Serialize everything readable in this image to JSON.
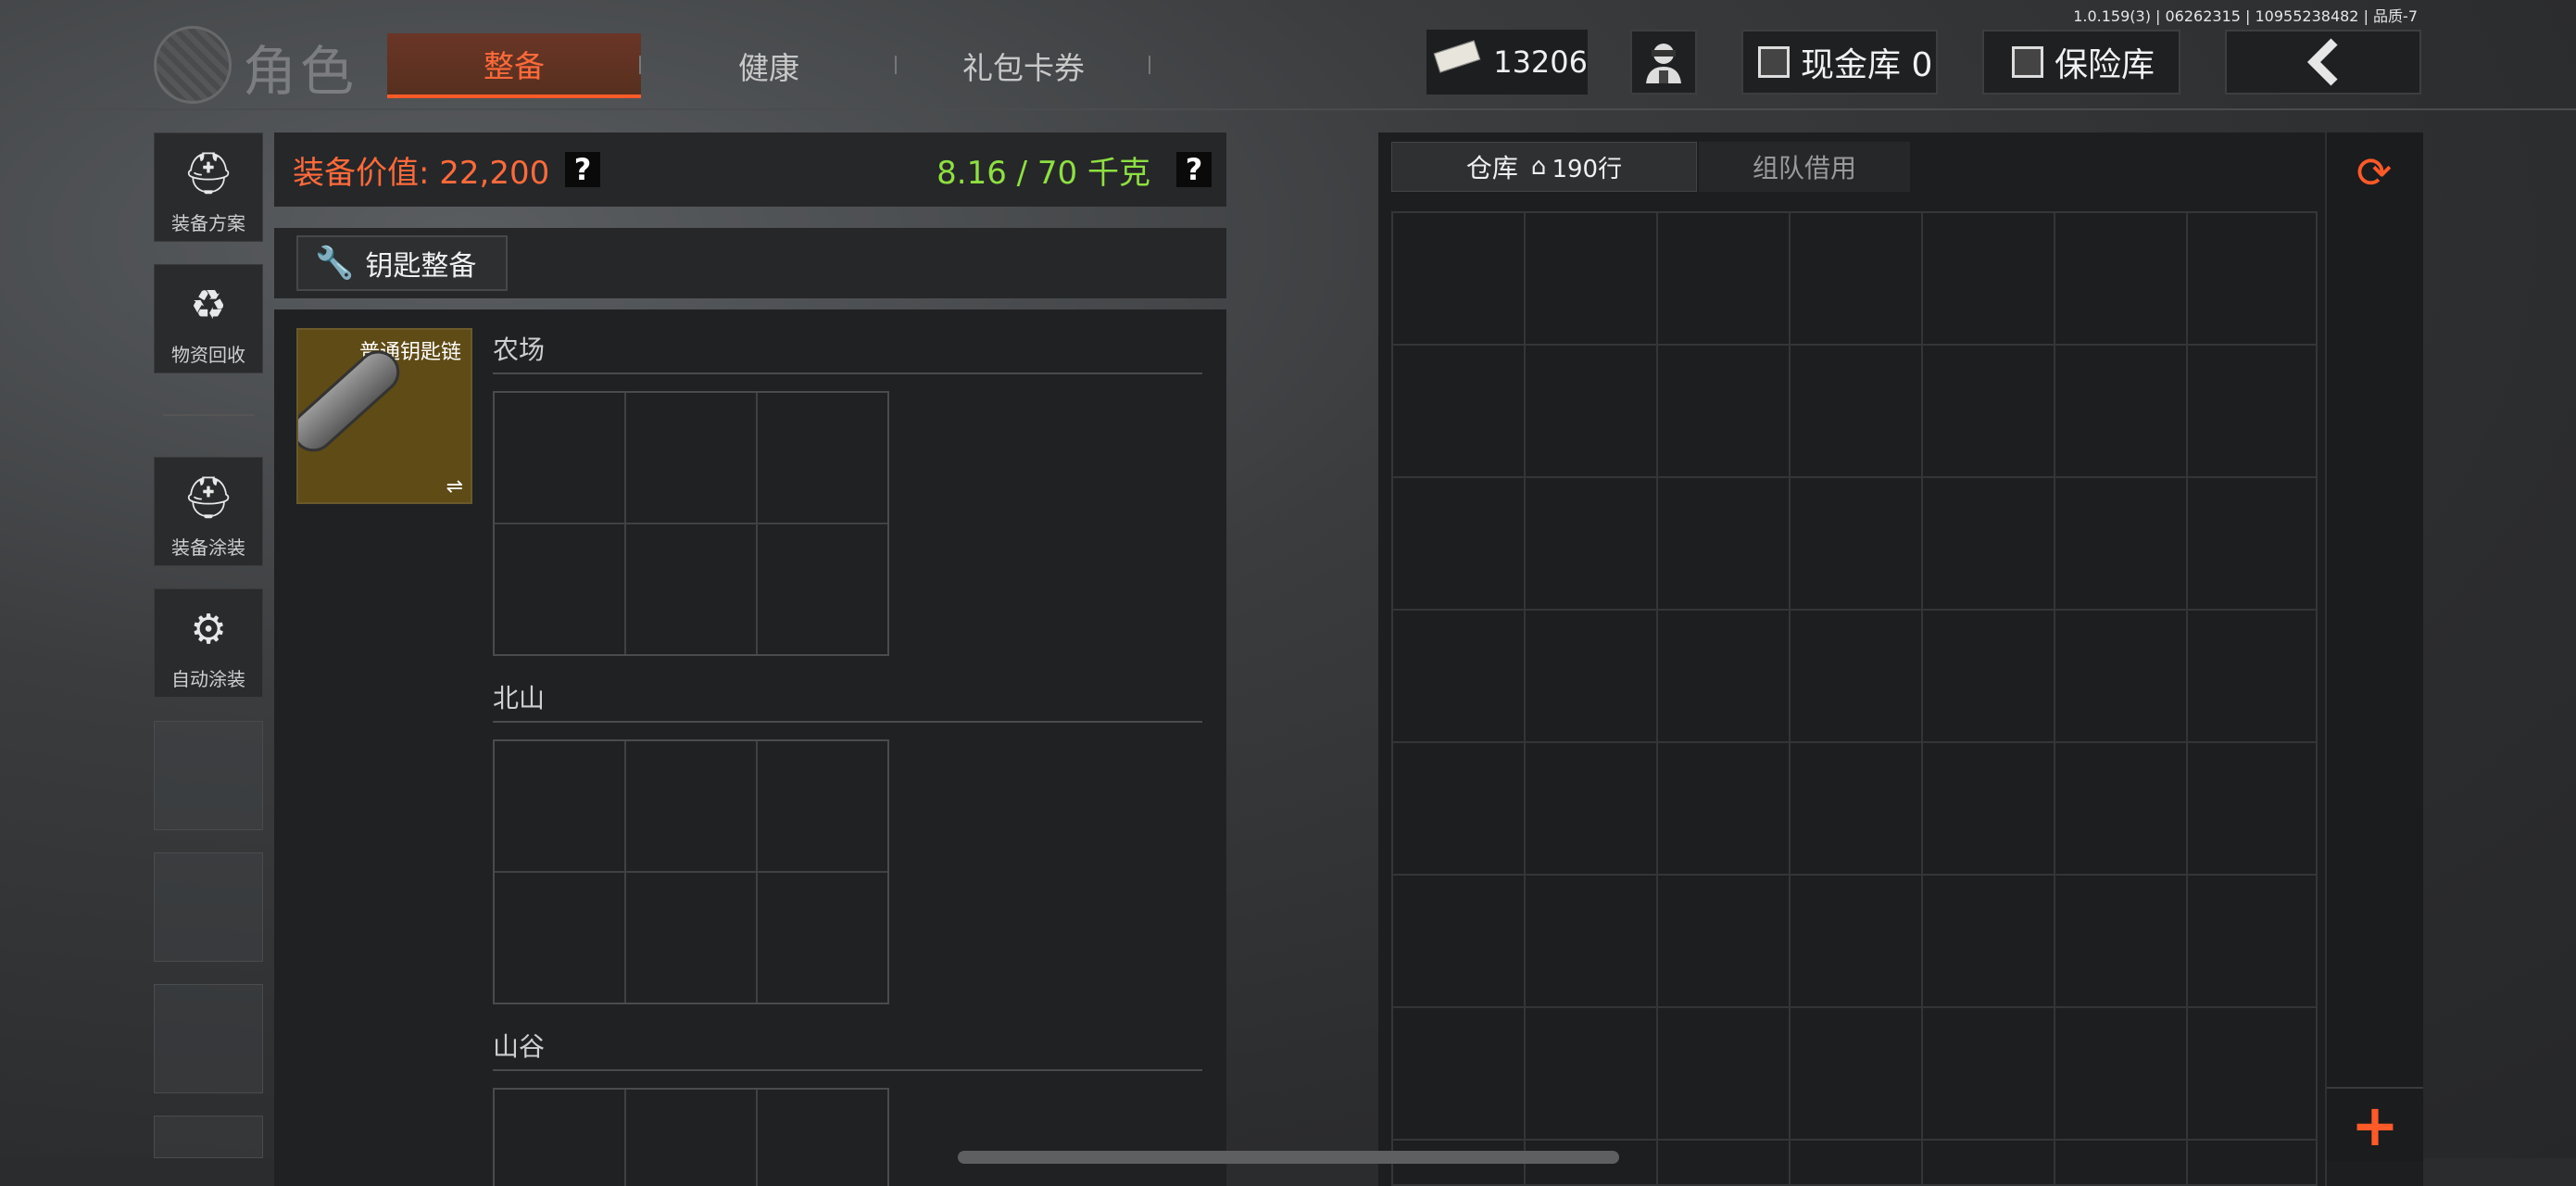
{
  "version": "1.0.159(3) | 06262315 | 10955238482 | 品质-7",
  "header": {
    "title": "角色",
    "tabs": [
      {
        "label": "整备",
        "active": true
      },
      {
        "label": "健康",
        "active": false
      },
      {
        "label": "礼包卡券",
        "active": false
      }
    ],
    "money": "13206",
    "cash_vault": "现金库 0",
    "safe": "保险库"
  },
  "sidebar": {
    "items": [
      {
        "label": "装备方案",
        "icon": "helmet-grid-icon"
      },
      {
        "label": "物资回收",
        "icon": "recycle-icon"
      },
      {
        "label": "装备涂装",
        "icon": "helmet-paint-icon"
      },
      {
        "label": "自动涂装",
        "icon": "brush-gear-icon"
      }
    ]
  },
  "equipment": {
    "value_label": "装备价值: 22,200",
    "weight_label": "8.16 / 70 千克",
    "help": "?",
    "key_button": "钥匙整备",
    "keychain": {
      "label": "普通钥匙链",
      "swap": "⇌"
    },
    "regions": [
      "农场",
      "北山",
      "山谷"
    ]
  },
  "warehouse": {
    "tab_label": "仓库",
    "rows": "190行",
    "team_tab": "组队借用",
    "add": "+"
  },
  "colors": {
    "accent": "#ff5a28",
    "value": "#ff6a3a",
    "weight": "#8ee041"
  }
}
